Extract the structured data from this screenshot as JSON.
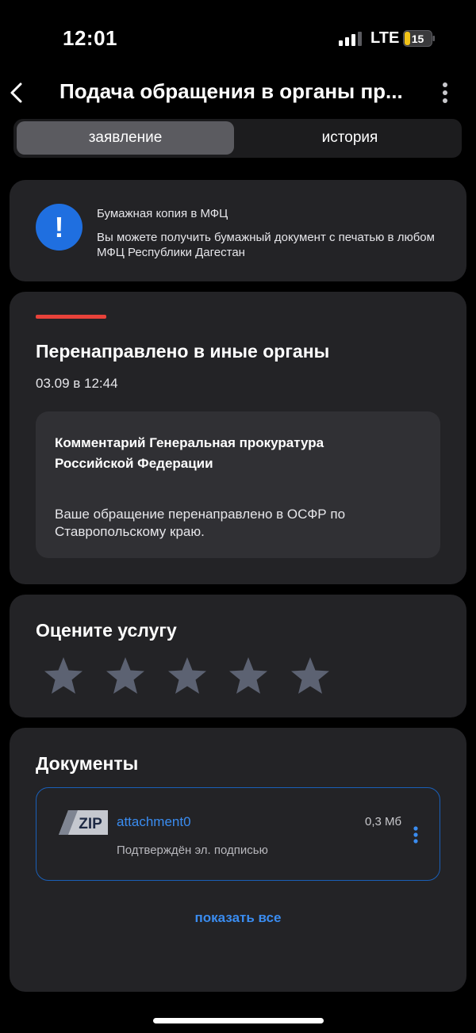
{
  "status_bar": {
    "time": "12:01",
    "network": "LTE",
    "battery": "15"
  },
  "nav": {
    "title": "Подача обращения в органы пр...",
    "back_icon": "chevron-left-icon",
    "more_icon": "vertical-dots-icon"
  },
  "tabs": [
    {
      "label": "заявление",
      "active": true
    },
    {
      "label": "история",
      "active": false
    }
  ],
  "info": {
    "icon": "exclamation-icon",
    "title": "Бумажная копия в МФЦ",
    "text": "Вы можете получить бумажный документ с печатью в любом МФЦ Республики Дагестан"
  },
  "status": {
    "title": "Перенаправлено в иные органы",
    "date": "03.09 в 12:44",
    "comment_title": "Комментарий Генеральная прокуратура Российской Федерации",
    "comment_text": "Ваше обращение перенаправлено в ОСФР по Ставропольскому краю.",
    "accent_color": "#e8423a"
  },
  "rating": {
    "title": "Оцените услугу",
    "stars_total": 5,
    "stars_selected": 0
  },
  "documents": {
    "title": "Документы",
    "items": [
      {
        "type": "ZIP",
        "name": "attachment0",
        "size": "0,3 Мб",
        "status": "Подтверждён эл. подписью"
      }
    ],
    "show_all": "показать все"
  },
  "colors": {
    "accent": "#3a8cf0",
    "info_icon": "#1f6fe0",
    "card": "#232326"
  }
}
